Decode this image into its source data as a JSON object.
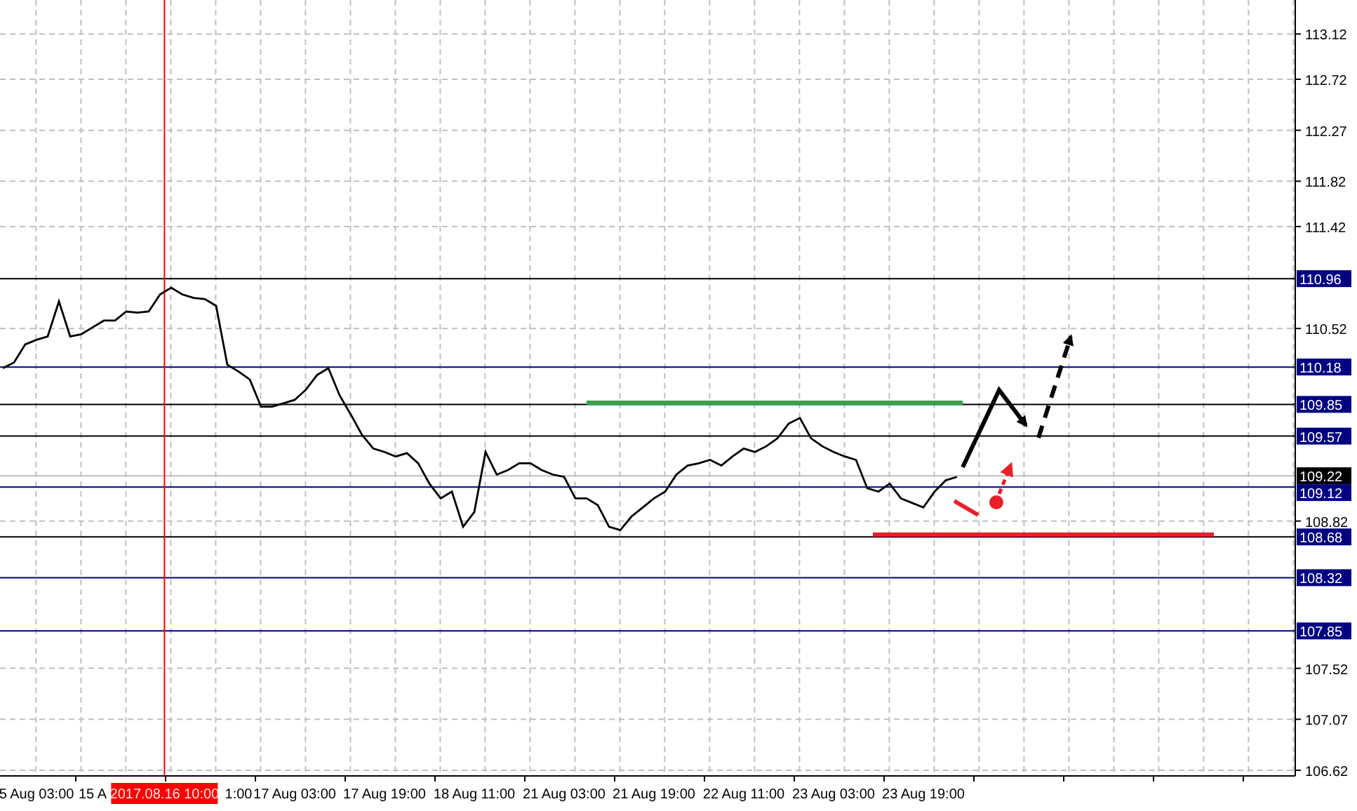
{
  "chart": {
    "chart_data": {
      "type": "line",
      "grid": true,
      "ylim": [
        106.57,
        113.42
      ],
      "yticks": [
        113.12,
        112.72,
        112.27,
        111.82,
        111.42,
        110.52,
        108.82,
        107.52,
        107.07,
        106.62
      ],
      "categories": [
        null,
        null,
        null,
        "5 Aug 03:00",
        null,
        null,
        null,
        null,
        "15 A",
        null,
        null,
        null,
        null,
        null,
        null,
        null,
        null,
        null,
        null,
        null,
        null,
        "1:00",
        null,
        null,
        null,
        null,
        "17 Aug 03:00",
        null,
        null,
        null,
        null,
        null,
        null,
        null,
        "17 Aug 19:00",
        null,
        null,
        null,
        null,
        null,
        null,
        null,
        "18 Aug 11:00",
        null,
        null,
        null,
        null,
        null,
        null,
        null,
        "21 Aug 03:00",
        null,
        null,
        null,
        null,
        null,
        null,
        null,
        "21 Aug 19:00",
        null,
        null,
        null,
        null,
        null,
        null,
        null,
        "22 Aug 11:00",
        null,
        null,
        null,
        null,
        null,
        null,
        null,
        "23 Aug 03:00",
        null,
        null,
        null,
        null,
        null,
        null,
        null,
        "23 Aug 19:00",
        null,
        null,
        null
      ],
      "series": [
        {
          "color": "#000000",
          "values": [
            110.17,
            110.22,
            110.38,
            110.42,
            110.45,
            110.76,
            110.45,
            110.47,
            110.53,
            110.59,
            110.59,
            110.67,
            110.66,
            110.67,
            110.82,
            110.88,
            110.82,
            110.79,
            110.78,
            110.72,
            110.2,
            110.14,
            110.07,
            109.83,
            109.83,
            109.86,
            109.89,
            109.98,
            110.11,
            110.17,
            109.93,
            109.76,
            109.58,
            109.46,
            109.43,
            109.39,
            109.42,
            109.33,
            109.15,
            109.02,
            109.08,
            108.77,
            108.9,
            109.43,
            109.23,
            109.27,
            109.33,
            109.33,
            109.27,
            109.23,
            109.21,
            109.02,
            109.02,
            108.96,
            108.77,
            108.74,
            108.86,
            108.94,
            109.02,
            109.08,
            109.23,
            109.31,
            109.33,
            109.36,
            109.31,
            109.39,
            109.46,
            109.43,
            109.48,
            109.55,
            109.68,
            109.73,
            109.55,
            109.48,
            109.43,
            109.39,
            109.36,
            109.11,
            109.08,
            109.15,
            109.02,
            108.98,
            108.94,
            109.08,
            109.18,
            109.21
          ]
        }
      ],
      "ref_lines": [
        {
          "axis": "y",
          "value": 110.96,
          "label": "110.96",
          "color": "#000000"
        },
        {
          "axis": "y",
          "value": 110.18,
          "label": "110.18",
          "color": "#000080"
        },
        {
          "axis": "y",
          "value": 109.85,
          "label": "109.85",
          "color": "#000000"
        },
        {
          "axis": "y",
          "value": 109.57,
          "label": "109.57",
          "color": "#000000"
        },
        {
          "axis": "y",
          "value": 109.22,
          "label": "109.22",
          "color": "#c0c0c0"
        },
        {
          "axis": "y",
          "value": 109.12,
          "label": "109.12",
          "color": "#000080"
        },
        {
          "axis": "y",
          "value": 108.68,
          "label": "108.68",
          "color": "#000000"
        },
        {
          "axis": "y",
          "value": 108.32,
          "label": "108.32",
          "color": "#000080"
        },
        {
          "axis": "y",
          "value": 107.85,
          "label": "107.85",
          "color": "#000080"
        }
      ]
    },
    "cursor": {
      "label": "2017.08.16 10:00"
    }
  }
}
